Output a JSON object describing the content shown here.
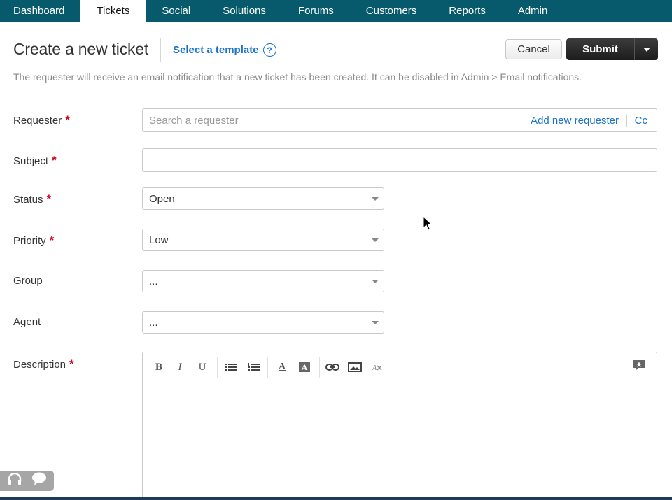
{
  "nav": {
    "tabs": [
      {
        "label": "Dashboard",
        "active": false
      },
      {
        "label": "Tickets",
        "active": true
      },
      {
        "label": "Social",
        "active": false
      },
      {
        "label": "Solutions",
        "active": false
      },
      {
        "label": "Forums",
        "active": false
      },
      {
        "label": "Customers",
        "active": false
      },
      {
        "label": "Reports",
        "active": false
      },
      {
        "label": "Admin",
        "active": false
      }
    ]
  },
  "header": {
    "title": "Create a new ticket",
    "template_link": "Select a template",
    "help_glyph": "?",
    "cancel_label": "Cancel",
    "submit_label": "Submit"
  },
  "notice": "The requester will receive an email notification that a new ticket has been created. It can be disabled in Admin > Email notifications.",
  "form": {
    "requester": {
      "label": "Requester",
      "required_mark": "*",
      "placeholder": "Search a requester",
      "add_new_label": "Add new requester",
      "cc_label": "Cc"
    },
    "subject": {
      "label": "Subject",
      "required_mark": "*",
      "value": ""
    },
    "status": {
      "label": "Status",
      "required_mark": "*",
      "value": "Open"
    },
    "priority": {
      "label": "Priority",
      "required_mark": "*",
      "value": "Low"
    },
    "group": {
      "label": "Group",
      "value": "..."
    },
    "agent": {
      "label": "Agent",
      "value": "..."
    },
    "description": {
      "label": "Description",
      "required_mark": "*"
    }
  },
  "editor_toolbar": {
    "buttons": [
      {
        "icon": "bold-icon",
        "glyph": "B"
      },
      {
        "icon": "italic-icon",
        "glyph": "I"
      },
      {
        "icon": "underline-icon",
        "glyph": "U"
      },
      {
        "icon": "bullet-list-icon"
      },
      {
        "icon": "numbered-list-icon"
      },
      {
        "icon": "font-color-icon",
        "glyph": "A"
      },
      {
        "icon": "background-color-icon",
        "glyph": "A"
      },
      {
        "icon": "link-icon"
      },
      {
        "icon": "image-icon"
      },
      {
        "icon": "clear-formatting-icon"
      },
      {
        "icon": "canned-response-icon"
      }
    ]
  },
  "colors": {
    "nav_bg": "#065a6b",
    "link": "#1a73c9",
    "required": "#d0021b",
    "submit_bg": "#1c1c1c"
  }
}
